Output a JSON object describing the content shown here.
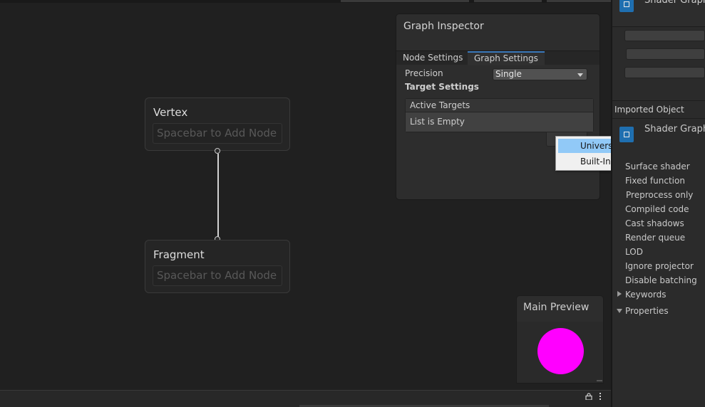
{
  "graph": {
    "vertex_node": {
      "title": "Vertex",
      "placeholder": "Spacebar to Add Node"
    },
    "fragment_node": {
      "title": "Fragment",
      "placeholder": "Spacebar to Add Node"
    }
  },
  "graph_inspector": {
    "title": "Graph Inspector",
    "tabs": [
      "Node Settings",
      "Graph Settings"
    ],
    "active_tab": "Graph Settings",
    "precision_label": "Precision",
    "precision_value": "Single",
    "target_settings_label": "Target Settings",
    "active_targets_label": "Active Targets",
    "list_empty_text": "List is Empty",
    "add_button_icon": "plus-icon"
  },
  "target_menu": {
    "items": [
      "Universal",
      "Built-In"
    ],
    "highlighted": "Universal"
  },
  "main_preview": {
    "title": "Main Preview",
    "sphere_color": "#ff00ff"
  },
  "right_panel": {
    "asset_title": "Shader Graph",
    "imported_object_label": "Imported Object",
    "imported_asset_title": "Shader Graph",
    "rows": [
      "Surface shader",
      "Fixed function",
      "Preprocess only",
      "Compiled code",
      "Cast shadows",
      "Render queue",
      "LOD",
      "Ignore projector",
      "Disable batching"
    ],
    "keywords_label": "Keywords",
    "properties_label": "Properties"
  },
  "colors": {
    "accent": "#3a79bb",
    "menu_highlight": "#91c9f7",
    "asset_icon": "#1f6fb0"
  }
}
